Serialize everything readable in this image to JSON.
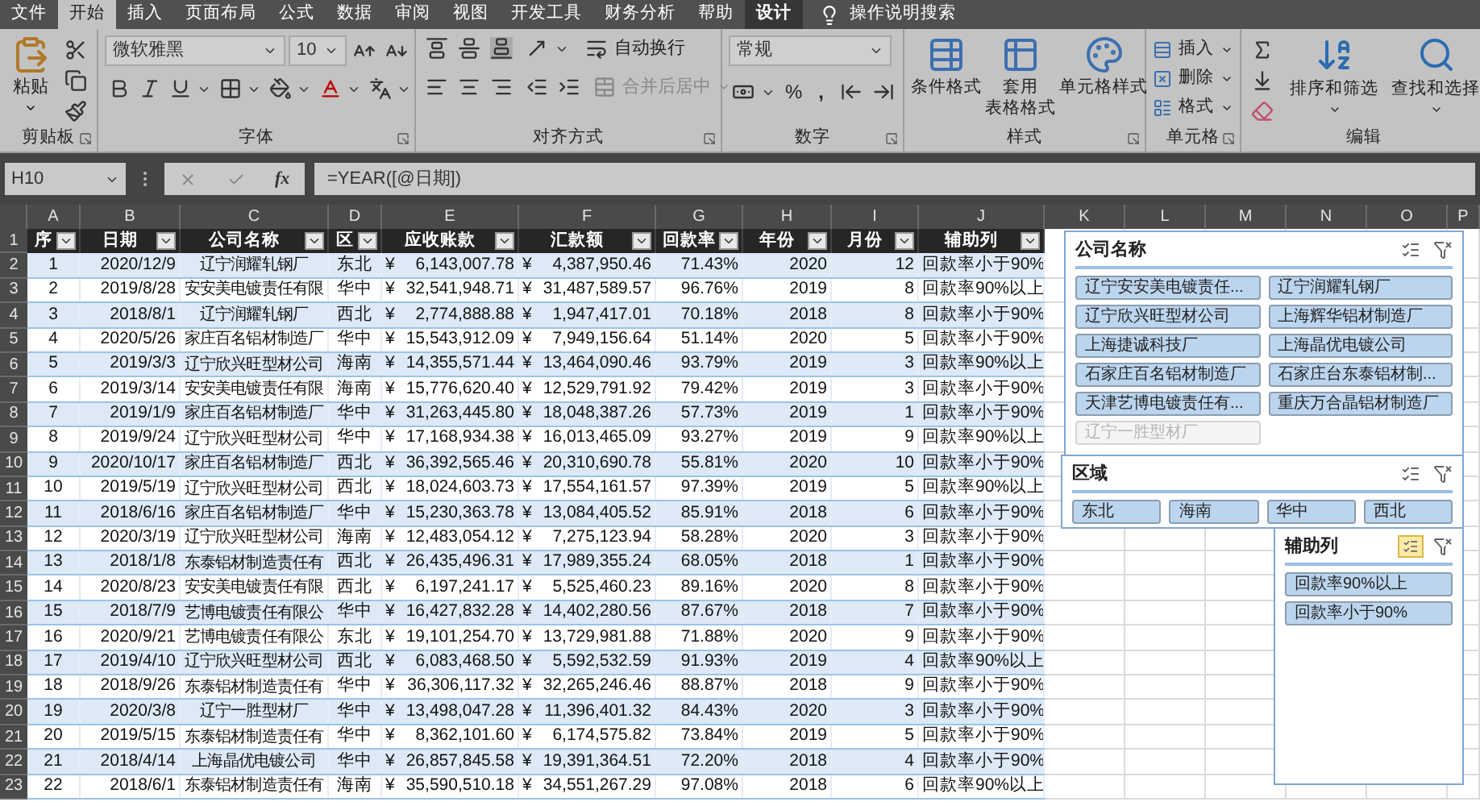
{
  "tabs": [
    {
      "label": "文件",
      "selected": false,
      "contextual": false
    },
    {
      "label": "开始",
      "selected": true,
      "contextual": false
    },
    {
      "label": "插入",
      "selected": false,
      "contextual": false
    },
    {
      "label": "页面布局",
      "selected": false,
      "contextual": false
    },
    {
      "label": "公式",
      "selected": false,
      "contextual": false
    },
    {
      "label": "数据",
      "selected": false,
      "contextual": false
    },
    {
      "label": "审阅",
      "selected": false,
      "contextual": false
    },
    {
      "label": "视图",
      "selected": false,
      "contextual": false
    },
    {
      "label": "开发工具",
      "selected": false,
      "contextual": false
    },
    {
      "label": "财务分析",
      "selected": false,
      "contextual": false
    },
    {
      "label": "帮助",
      "selected": false,
      "contextual": false
    },
    {
      "label": "设计",
      "selected": false,
      "contextual": true
    }
  ],
  "tell_me": "操作说明搜索",
  "clipboard": {
    "label": "剪贴板",
    "paste": "粘贴"
  },
  "font": {
    "label": "字体",
    "name": "微软雅黑",
    "size": "10"
  },
  "alignment": {
    "label": "对齐方式",
    "wrap": "自动换行",
    "merge": "合并后居中",
    "merge_disabled": true
  },
  "number": {
    "label": "数字",
    "format": "常规",
    "percent": "%",
    "comma": ","
  },
  "styles": {
    "label": "样式",
    "buttons": [
      {
        "lines": [
          "条件格式"
        ]
      },
      {
        "lines": [
          "套用",
          "表格格式"
        ]
      },
      {
        "lines": [
          "单元格样式"
        ]
      }
    ]
  },
  "cells": {
    "label": "单元格",
    "buttons": [
      "插入",
      "删除",
      "格式"
    ]
  },
  "editing": {
    "label": "编辑",
    "buttons": [
      "排序和筛选",
      "查找和选择"
    ]
  },
  "formula_bar": {
    "name_box": "H10",
    "fx": "fx",
    "formula": "=YEAR([@日期])"
  },
  "columns": [
    "A",
    "B",
    "C",
    "D",
    "E",
    "F",
    "G",
    "H",
    "I",
    "J",
    "K",
    "L",
    "M",
    "N",
    "O",
    "P"
  ],
  "table": {
    "header_row": "1",
    "headers": [
      "序",
      "日期",
      "公司名称",
      "区",
      "应收账款",
      "汇款额",
      "回款率",
      "年份",
      "月份",
      "辅助列"
    ],
    "rows": [
      {
        "n": "2",
        "cells": [
          "1",
          "2020/12/9",
          "辽宁润耀轧钢厂",
          "东北",
          "¥",
          "6,143,007.78",
          "¥",
          "4,387,950.46",
          "71.43%",
          "2020",
          "12",
          "回款率小于90%"
        ]
      },
      {
        "n": "3",
        "cells": [
          "2",
          "2019/8/28",
          "安安美电镀责任有限",
          "华中",
          "¥",
          "32,541,948.71",
          "¥",
          "31,487,589.57",
          "96.76%",
          "2019",
          "8",
          "回款率90%以上"
        ]
      },
      {
        "n": "4",
        "cells": [
          "3",
          "2018/8/1",
          "辽宁润耀轧钢厂",
          "西北",
          "¥",
          "2,774,888.88",
          "¥",
          "1,947,417.01",
          "70.18%",
          "2018",
          "8",
          "回款率小于90%"
        ]
      },
      {
        "n": "5",
        "cells": [
          "4",
          "2020/5/26",
          "家庄百名铝材制造厂",
          "华中",
          "¥",
          "15,543,912.09",
          "¥",
          "7,949,156.64",
          "51.14%",
          "2020",
          "5",
          "回款率小于90%"
        ]
      },
      {
        "n": "6",
        "cells": [
          "5",
          "2019/3/3",
          "辽宁欣兴旺型材公司",
          "海南",
          "¥",
          "14,355,571.44",
          "¥",
          "13,464,090.46",
          "93.79%",
          "2019",
          "3",
          "回款率90%以上"
        ]
      },
      {
        "n": "7",
        "cells": [
          "6",
          "2019/3/14",
          "安安美电镀责任有限",
          "海南",
          "¥",
          "15,776,620.40",
          "¥",
          "12,529,791.92",
          "79.42%",
          "2019",
          "3",
          "回款率小于90%"
        ]
      },
      {
        "n": "8",
        "cells": [
          "7",
          "2019/1/9",
          "家庄百名铝材制造厂",
          "华中",
          "¥",
          "31,263,445.80",
          "¥",
          "18,048,387.26",
          "57.73%",
          "2019",
          "1",
          "回款率小于90%"
        ]
      },
      {
        "n": "9",
        "cells": [
          "8",
          "2019/9/24",
          "辽宁欣兴旺型材公司",
          "华中",
          "¥",
          "17,168,934.38",
          "¥",
          "16,013,465.09",
          "93.27%",
          "2019",
          "9",
          "回款率90%以上"
        ]
      },
      {
        "n": "10",
        "cells": [
          "9",
          "2020/10/17",
          "家庄百名铝材制造厂",
          "西北",
          "¥",
          "36,392,565.46",
          "¥",
          "20,310,690.78",
          "55.81%",
          "2020",
          "10",
          "回款率小于90%"
        ]
      },
      {
        "n": "11",
        "cells": [
          "10",
          "2019/5/19",
          "辽宁欣兴旺型材公司",
          "西北",
          "¥",
          "18,024,603.73",
          "¥",
          "17,554,161.57",
          "97.39%",
          "2019",
          "5",
          "回款率90%以上"
        ]
      },
      {
        "n": "12",
        "cells": [
          "11",
          "2018/6/16",
          "家庄百名铝材制造厂",
          "华中",
          "¥",
          "15,230,363.78",
          "¥",
          "13,084,405.52",
          "85.91%",
          "2018",
          "6",
          "回款率小于90%"
        ]
      },
      {
        "n": "13",
        "cells": [
          "12",
          "2020/3/19",
          "辽宁欣兴旺型材公司",
          "海南",
          "¥",
          "12,483,054.12",
          "¥",
          "7,275,123.94",
          "58.28%",
          "2020",
          "3",
          "回款率小于90%"
        ]
      },
      {
        "n": "14",
        "cells": [
          "13",
          "2018/1/8",
          "东泰铝材制造责任有",
          "西北",
          "¥",
          "26,435,496.31",
          "¥",
          "17,989,355.24",
          "68.05%",
          "2018",
          "1",
          "回款率小于90%"
        ]
      },
      {
        "n": "15",
        "cells": [
          "14",
          "2020/8/23",
          "安安美电镀责任有限",
          "西北",
          "¥",
          "6,197,241.17",
          "¥",
          "5,525,460.23",
          "89.16%",
          "2020",
          "8",
          "回款率小于90%"
        ]
      },
      {
        "n": "16",
        "cells": [
          "15",
          "2018/7/9",
          "艺博电镀责任有限公",
          "华中",
          "¥",
          "16,427,832.28",
          "¥",
          "14,402,280.56",
          "87.67%",
          "2018",
          "7",
          "回款率小于90%"
        ]
      },
      {
        "n": "17",
        "cells": [
          "16",
          "2020/9/21",
          "艺博电镀责任有限公",
          "东北",
          "¥",
          "19,101,254.70",
          "¥",
          "13,729,981.88",
          "71.88%",
          "2020",
          "9",
          "回款率小于90%"
        ]
      },
      {
        "n": "18",
        "cells": [
          "17",
          "2019/4/10",
          "辽宁欣兴旺型材公司",
          "西北",
          "¥",
          "6,083,468.50",
          "¥",
          "5,592,532.59",
          "91.93%",
          "2019",
          "4",
          "回款率90%以上"
        ]
      },
      {
        "n": "19",
        "cells": [
          "18",
          "2018/9/26",
          "东泰铝材制造责任有",
          "华中",
          "¥",
          "36,306,117.32",
          "¥",
          "32,265,246.46",
          "88.87%",
          "2018",
          "9",
          "回款率小于90%"
        ]
      },
      {
        "n": "20",
        "cells": [
          "19",
          "2020/3/8",
          "辽宁一胜型材厂",
          "华中",
          "¥",
          "13,498,047.28",
          "¥",
          "11,396,401.32",
          "84.43%",
          "2020",
          "3",
          "回款率小于90%"
        ]
      },
      {
        "n": "21",
        "cells": [
          "20",
          "2019/5/15",
          "东泰铝材制造责任有",
          "华中",
          "¥",
          "8,362,101.60",
          "¥",
          "6,174,575.82",
          "73.84%",
          "2019",
          "5",
          "回款率小于90%"
        ]
      },
      {
        "n": "22",
        "cells": [
          "21",
          "2018/4/14",
          "上海晶优电镀公司",
          "华中",
          "¥",
          "26,857,845.58",
          "¥",
          "19,391,364.51",
          "72.20%",
          "2018",
          "4",
          "回款率小于90%"
        ]
      },
      {
        "n": "23",
        "cells": [
          "22",
          "2018/6/1",
          "东泰铝材制造责任有",
          "海南",
          "¥",
          "35,590,510.18",
          "¥",
          "34,551,267.29",
          "97.08%",
          "2018",
          "6",
          "回款率90%以上"
        ]
      }
    ]
  },
  "slicers": [
    {
      "title": "公司名称",
      "multi_select": false,
      "items": [
        {
          "label": "辽宁安安美电镀责任...",
          "selected": true,
          "available": true
        },
        {
          "label": "辽宁润耀轧钢厂",
          "selected": true,
          "available": true
        },
        {
          "label": "辽宁欣兴旺型材公司",
          "selected": true,
          "available": true
        },
        {
          "label": "上海辉华铝材制造厂",
          "selected": true,
          "available": true
        },
        {
          "label": "上海捷诚科技厂",
          "selected": true,
          "available": true
        },
        {
          "label": "上海晶优电镀公司",
          "selected": true,
          "available": true
        },
        {
          "label": "石家庄百名铝材制造厂",
          "selected": true,
          "available": true
        },
        {
          "label": "石家庄台东泰铝材制...",
          "selected": true,
          "available": true
        },
        {
          "label": "天津艺博电镀责任有...",
          "selected": true,
          "available": true
        },
        {
          "label": "重庆万合晶铝材制造厂",
          "selected": true,
          "available": true
        },
        {
          "label": "辽宁一胜型材厂",
          "selected": false,
          "available": false
        }
      ]
    },
    {
      "title": "区域",
      "multi_select": false,
      "items": [
        {
          "label": "东北",
          "selected": true,
          "available": true
        },
        {
          "label": "海南",
          "selected": true,
          "available": true
        },
        {
          "label": "华中",
          "selected": true,
          "available": true
        },
        {
          "label": "西北",
          "selected": true,
          "available": true
        }
      ]
    },
    {
      "title": "辅助列",
      "multi_select": true,
      "items": [
        {
          "label": "回款率90%以上",
          "selected": true,
          "available": true
        },
        {
          "label": "回款率小于90%",
          "selected": true,
          "available": true
        }
      ]
    }
  ]
}
